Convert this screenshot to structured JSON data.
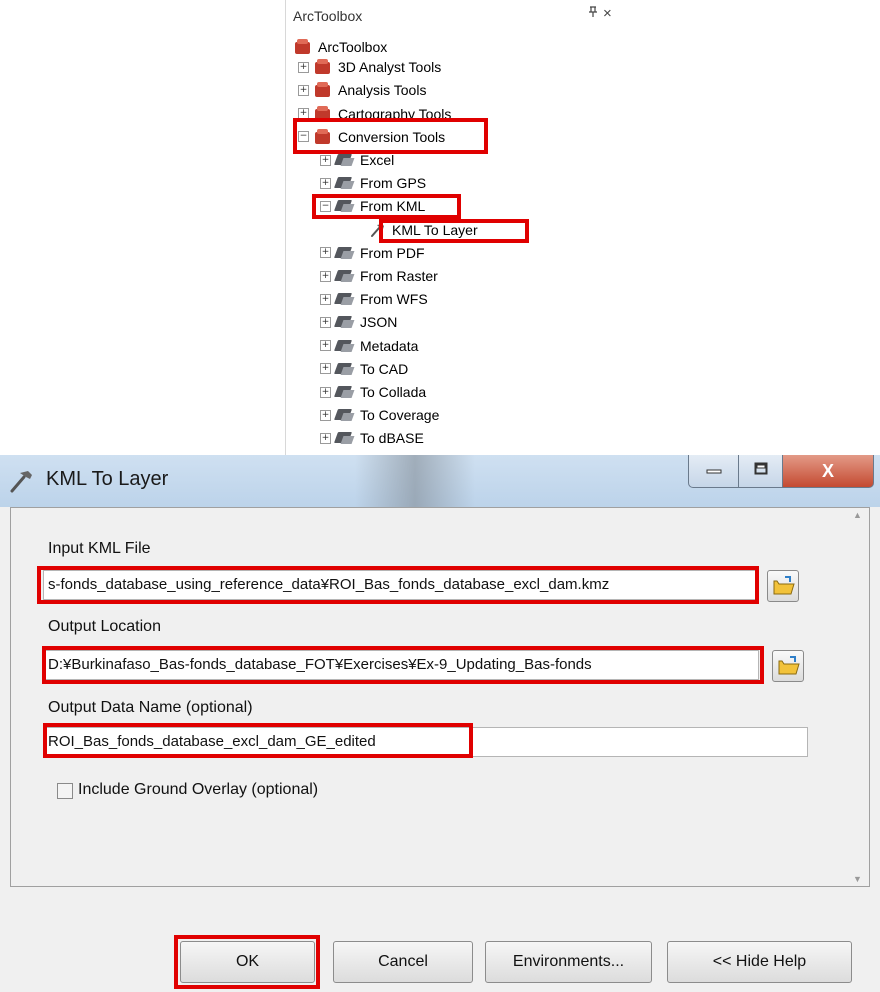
{
  "toolbox": {
    "title": "ArcToolbox",
    "pin_glyph": "1",
    "close_glyph": "×",
    "root_label": "ArcToolbox",
    "items": [
      {
        "label": "3D Analyst Tools",
        "expander": "+"
      },
      {
        "label": "Analysis Tools",
        "expander": "+"
      },
      {
        "label": "Cartography Tools",
        "expander": "+"
      },
      {
        "label": "Conversion Tools",
        "expander": "−"
      }
    ],
    "conversion_children": [
      {
        "label": "Excel",
        "expander": "+"
      },
      {
        "label": "From GPS",
        "expander": "+"
      },
      {
        "label": "From KML",
        "expander": "−"
      },
      {
        "label": "KML To Layer",
        "tool": true
      },
      {
        "label": "From PDF",
        "expander": "+"
      },
      {
        "label": "From Raster",
        "expander": "+"
      },
      {
        "label": "From WFS",
        "expander": "+"
      },
      {
        "label": "JSON",
        "expander": "+"
      },
      {
        "label": "Metadata",
        "expander": "+"
      },
      {
        "label": "To CAD",
        "expander": "+"
      },
      {
        "label": "To Collada",
        "expander": "+"
      },
      {
        "label": "To Coverage",
        "expander": "+"
      },
      {
        "label": "To dBASE",
        "expander": "+"
      }
    ]
  },
  "dialog": {
    "title": "KML To Layer",
    "close_glyph": "X",
    "input_kml_label": "Input KML File",
    "input_kml_value": "s-fonds_database_using_reference_data¥ROI_Bas_fonds_database_excl_dam.kmz",
    "output_location_label": "Output Location",
    "output_location_value": "D:¥Burkinafaso_Bas-fonds_database_FOT¥Exercises¥Ex-9_Updating_Bas-fonds",
    "output_name_label": "Output Data Name (optional)",
    "output_name_value": "ROI_Bas_fonds_database_excl_dam_GE_edited",
    "ground_overlay_label": "Include Ground Overlay (optional)",
    "ground_overlay_checked": false,
    "buttons": {
      "ok": "OK",
      "cancel": "Cancel",
      "environments": "Environments...",
      "hide_help": "<< Hide Help"
    }
  },
  "colors": {
    "highlight": "#e00000",
    "toolbox_icon": "#c0392b",
    "close_button": "#c44a31"
  }
}
